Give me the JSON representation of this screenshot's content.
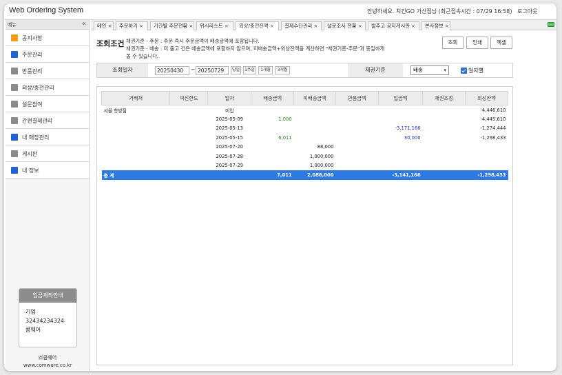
{
  "app": {
    "title": "Web Ordering System",
    "greeting": "안녕하세요. 치킨GO 가산점님 (최근접속시간 : 07/29 16:58)",
    "separator": "|",
    "logout_label": "로그아웃"
  },
  "sidebar": {
    "header_label": "메뉴",
    "collapse_label": "«",
    "items": [
      {
        "label": "공지사항",
        "color": "#f39c1a"
      },
      {
        "label": "주문관리",
        "color": "#1e63d0"
      },
      {
        "label": "반품관리",
        "color": "#8a8a8a"
      },
      {
        "label": "외상/충전관리",
        "color": "#8a8a8a"
      },
      {
        "label": "설문참여",
        "color": "#8a8a8a"
      },
      {
        "label": "간편결제관리",
        "color": "#8a8a8a"
      },
      {
        "label": "내 매장관리",
        "color": "#1e63d0"
      },
      {
        "label": "게시판",
        "color": "#8a8a8a"
      },
      {
        "label": "내 정보",
        "color": "#1e63d0"
      }
    ],
    "deposit": {
      "title": "입금계좌안내",
      "bank": "기업",
      "account": "32434234324",
      "holder": "콤웨어"
    },
    "company": {
      "name": "㈜콤웨어",
      "url": "www.comware.co.kr"
    }
  },
  "tabs": [
    {
      "label": "메인",
      "close": "×"
    },
    {
      "label": "주문하기",
      "close": "×"
    },
    {
      "label": "기간별 주문현황",
      "close": "×"
    },
    {
      "label": "위시리스트",
      "close": "×"
    },
    {
      "label": "외상/충전잔액",
      "close": "×",
      "active": true
    },
    {
      "label": "결제수단관리",
      "close": "×"
    },
    {
      "label": "설문조사 현황",
      "close": "×"
    },
    {
      "label": "발주고 공지게시판",
      "close": "×"
    },
    {
      "label": "본사정보",
      "close": "×"
    }
  ],
  "conditions": {
    "title": "조회조건",
    "desc_lines": [
      "채권기준 - 주문 : 주문 즉시 주문금액이 배송금액에 포함됩니다.",
      "채권기준 - 배송 : 미 출고 건은 배송금액에 포함하지 않으며, 미배송금액+외상잔액을 계산하면 \"채권기준-주문\"과 동일하게",
      "볼 수 있습니다."
    ],
    "buttons": {
      "search": "조회",
      "print": "인쇄",
      "excel": "엑셀"
    }
  },
  "filter": {
    "date_label": "조회일자",
    "date_from": "20250430",
    "tilde": "~",
    "date_to": "20250729",
    "quick": [
      "당일",
      "1주일",
      "1개월",
      "3개월"
    ],
    "basis_label": "채권기준",
    "basis_value": "배송",
    "daily_label": "일자별",
    "daily_checked": true
  },
  "grid": {
    "columns": [
      "거래처",
      "여신한도",
      "일자",
      "배송금액",
      "미배송금액",
      "반품금액",
      "입금액",
      "채권조정",
      "외상잔액"
    ],
    "rows": [
      {
        "store": "서울 항방점",
        "limit": "",
        "date": "미입",
        "ship": "",
        "unship": "",
        "ret": "",
        "deposit": "",
        "adj": "",
        "bal": "-4,446,610"
      },
      {
        "store": "",
        "limit": "",
        "date": "2025-05-09",
        "ship": "1,000",
        "unship": "",
        "ret": "",
        "deposit": "",
        "adj": "",
        "bal": "-4,445,610"
      },
      {
        "store": "",
        "limit": "",
        "date": "2025-05-13",
        "ship": "",
        "unship": "",
        "ret": "",
        "deposit": "-3,171,166",
        "adj": "",
        "bal": "-1,274,444"
      },
      {
        "store": "",
        "limit": "",
        "date": "2025-05-15",
        "ship": "6,011",
        "unship": "",
        "ret": "",
        "deposit": "30,000",
        "adj": "",
        "bal": "-1,298,433"
      },
      {
        "store": "",
        "limit": "",
        "date": "2025-07-20",
        "ship": "",
        "unship": "88,000",
        "ret": "",
        "deposit": "",
        "adj": "",
        "bal": ""
      },
      {
        "store": "",
        "limit": "",
        "date": "2025-07-28",
        "ship": "",
        "unship": "1,000,000",
        "ret": "",
        "deposit": "",
        "adj": "",
        "bal": ""
      },
      {
        "store": "",
        "limit": "",
        "date": "2025-07-29",
        "ship": "",
        "unship": "1,000,000",
        "ret": "",
        "deposit": "",
        "adj": "",
        "bal": ""
      }
    ],
    "total": {
      "label": "총 계",
      "ship": "7,011",
      "unship": "2,088,000",
      "deposit": "-3,141,166",
      "bal": "-1,298,433"
    }
  }
}
